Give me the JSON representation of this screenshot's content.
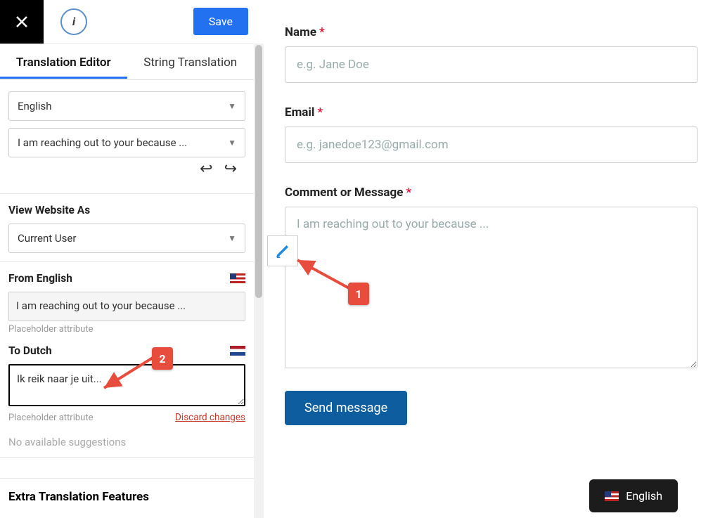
{
  "topbar": {
    "save_label": "Save"
  },
  "tabs": {
    "editor": "Translation Editor",
    "string": "String Translation"
  },
  "source_lang_dropdown": "English",
  "source_string_dropdown": "I am reaching out to your because ...",
  "view_as": {
    "label": "View Website As",
    "value": "Current User"
  },
  "from": {
    "label": "From English",
    "value": "I am reaching out to your because ...",
    "hint": "Placeholder attribute"
  },
  "to": {
    "label": "To Dutch",
    "value": "Ik reik naar je uit...",
    "hint": "Placeholder attribute",
    "discard": "Discard changes"
  },
  "no_suggestions": "No available suggestions",
  "extra_features": "Extra Translation Features",
  "form": {
    "name_label": "Name",
    "name_placeholder": "e.g. Jane Doe",
    "email_label": "Email",
    "email_placeholder": "e.g. janedoe123@gmail.com",
    "message_label": "Comment or Message",
    "message_placeholder": "I am reaching out to your because ...",
    "send_label": "Send message"
  },
  "callouts": {
    "one": "1",
    "two": "2"
  },
  "lang_switch": "English"
}
